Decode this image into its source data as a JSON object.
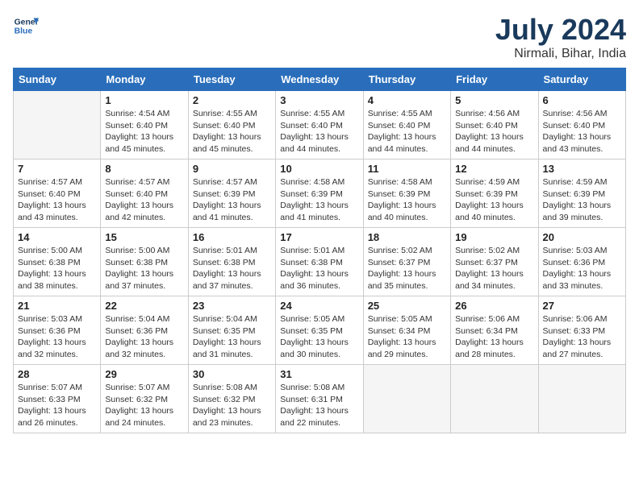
{
  "header": {
    "logo_line1": "General",
    "logo_line2": "Blue",
    "month_year": "July 2024",
    "location": "Nirmali, Bihar, India"
  },
  "weekdays": [
    "Sunday",
    "Monday",
    "Tuesday",
    "Wednesday",
    "Thursday",
    "Friday",
    "Saturday"
  ],
  "weeks": [
    [
      {
        "day": "",
        "info": ""
      },
      {
        "day": "1",
        "info": "Sunrise: 4:54 AM\nSunset: 6:40 PM\nDaylight: 13 hours\nand 45 minutes."
      },
      {
        "day": "2",
        "info": "Sunrise: 4:55 AM\nSunset: 6:40 PM\nDaylight: 13 hours\nand 45 minutes."
      },
      {
        "day": "3",
        "info": "Sunrise: 4:55 AM\nSunset: 6:40 PM\nDaylight: 13 hours\nand 44 minutes."
      },
      {
        "day": "4",
        "info": "Sunrise: 4:55 AM\nSunset: 6:40 PM\nDaylight: 13 hours\nand 44 minutes."
      },
      {
        "day": "5",
        "info": "Sunrise: 4:56 AM\nSunset: 6:40 PM\nDaylight: 13 hours\nand 44 minutes."
      },
      {
        "day": "6",
        "info": "Sunrise: 4:56 AM\nSunset: 6:40 PM\nDaylight: 13 hours\nand 43 minutes."
      }
    ],
    [
      {
        "day": "7",
        "info": "Sunrise: 4:57 AM\nSunset: 6:40 PM\nDaylight: 13 hours\nand 43 minutes."
      },
      {
        "day": "8",
        "info": "Sunrise: 4:57 AM\nSunset: 6:40 PM\nDaylight: 13 hours\nand 42 minutes."
      },
      {
        "day": "9",
        "info": "Sunrise: 4:57 AM\nSunset: 6:39 PM\nDaylight: 13 hours\nand 41 minutes."
      },
      {
        "day": "10",
        "info": "Sunrise: 4:58 AM\nSunset: 6:39 PM\nDaylight: 13 hours\nand 41 minutes."
      },
      {
        "day": "11",
        "info": "Sunrise: 4:58 AM\nSunset: 6:39 PM\nDaylight: 13 hours\nand 40 minutes."
      },
      {
        "day": "12",
        "info": "Sunrise: 4:59 AM\nSunset: 6:39 PM\nDaylight: 13 hours\nand 40 minutes."
      },
      {
        "day": "13",
        "info": "Sunrise: 4:59 AM\nSunset: 6:39 PM\nDaylight: 13 hours\nand 39 minutes."
      }
    ],
    [
      {
        "day": "14",
        "info": "Sunrise: 5:00 AM\nSunset: 6:38 PM\nDaylight: 13 hours\nand 38 minutes."
      },
      {
        "day": "15",
        "info": "Sunrise: 5:00 AM\nSunset: 6:38 PM\nDaylight: 13 hours\nand 37 minutes."
      },
      {
        "day": "16",
        "info": "Sunrise: 5:01 AM\nSunset: 6:38 PM\nDaylight: 13 hours\nand 37 minutes."
      },
      {
        "day": "17",
        "info": "Sunrise: 5:01 AM\nSunset: 6:38 PM\nDaylight: 13 hours\nand 36 minutes."
      },
      {
        "day": "18",
        "info": "Sunrise: 5:02 AM\nSunset: 6:37 PM\nDaylight: 13 hours\nand 35 minutes."
      },
      {
        "day": "19",
        "info": "Sunrise: 5:02 AM\nSunset: 6:37 PM\nDaylight: 13 hours\nand 34 minutes."
      },
      {
        "day": "20",
        "info": "Sunrise: 5:03 AM\nSunset: 6:36 PM\nDaylight: 13 hours\nand 33 minutes."
      }
    ],
    [
      {
        "day": "21",
        "info": "Sunrise: 5:03 AM\nSunset: 6:36 PM\nDaylight: 13 hours\nand 32 minutes."
      },
      {
        "day": "22",
        "info": "Sunrise: 5:04 AM\nSunset: 6:36 PM\nDaylight: 13 hours\nand 32 minutes."
      },
      {
        "day": "23",
        "info": "Sunrise: 5:04 AM\nSunset: 6:35 PM\nDaylight: 13 hours\nand 31 minutes."
      },
      {
        "day": "24",
        "info": "Sunrise: 5:05 AM\nSunset: 6:35 PM\nDaylight: 13 hours\nand 30 minutes."
      },
      {
        "day": "25",
        "info": "Sunrise: 5:05 AM\nSunset: 6:34 PM\nDaylight: 13 hours\nand 29 minutes."
      },
      {
        "day": "26",
        "info": "Sunrise: 5:06 AM\nSunset: 6:34 PM\nDaylight: 13 hours\nand 28 minutes."
      },
      {
        "day": "27",
        "info": "Sunrise: 5:06 AM\nSunset: 6:33 PM\nDaylight: 13 hours\nand 27 minutes."
      }
    ],
    [
      {
        "day": "28",
        "info": "Sunrise: 5:07 AM\nSunset: 6:33 PM\nDaylight: 13 hours\nand 26 minutes."
      },
      {
        "day": "29",
        "info": "Sunrise: 5:07 AM\nSunset: 6:32 PM\nDaylight: 13 hours\nand 24 minutes."
      },
      {
        "day": "30",
        "info": "Sunrise: 5:08 AM\nSunset: 6:32 PM\nDaylight: 13 hours\nand 23 minutes."
      },
      {
        "day": "31",
        "info": "Sunrise: 5:08 AM\nSunset: 6:31 PM\nDaylight: 13 hours\nand 22 minutes."
      },
      {
        "day": "",
        "info": ""
      },
      {
        "day": "",
        "info": ""
      },
      {
        "day": "",
        "info": ""
      }
    ]
  ]
}
